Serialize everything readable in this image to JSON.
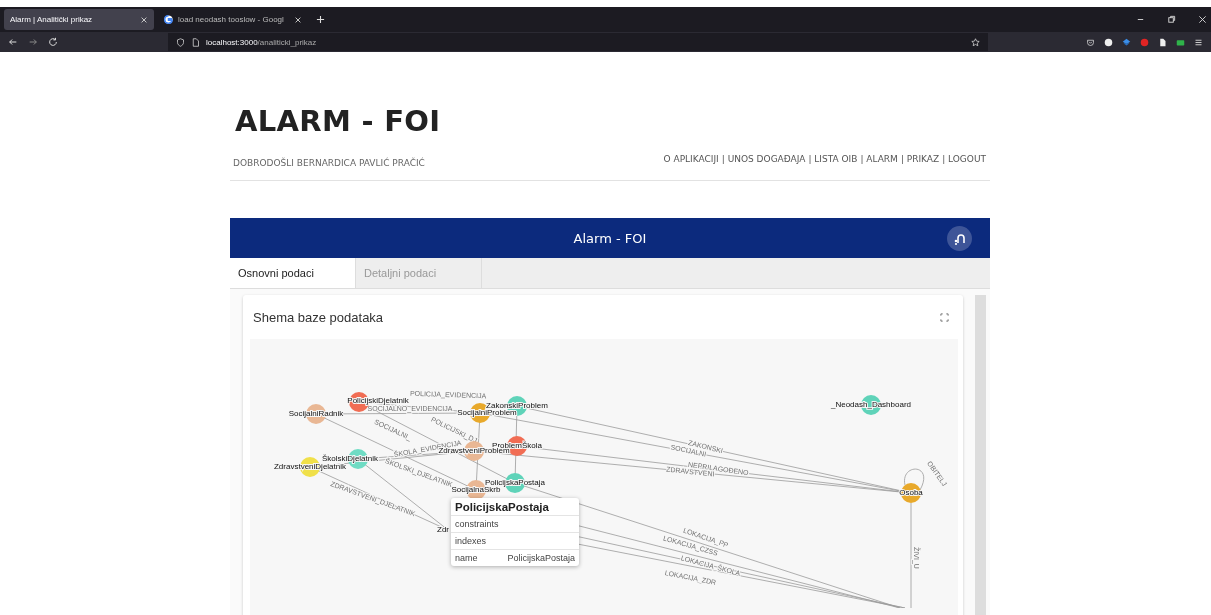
{
  "browser": {
    "tabs": [
      {
        "title": "Alarm | Analitički prikaz",
        "selected": true,
        "favicon": false
      },
      {
        "title": "load neodash tooslow - Googl",
        "selected": false,
        "favicon": true
      }
    ],
    "url_host": "localhost:3000",
    "url_path": "/analiticki_prikaz"
  },
  "site": {
    "title": "ALARM - FOI",
    "welcome": "DOBRODOŠLI BERNARDICA PAVLIĆ PRAČIĆ",
    "nav": [
      "O APLIKACIJI",
      "| UNOS DOGAĐAJA",
      "| LISTA OIB",
      "| ALARM",
      "| PRIKAZ",
      "| LOGOUT"
    ]
  },
  "app_bar": {
    "title": "Alarm - FOI"
  },
  "tabs": [
    {
      "label": "Osnovni podaci",
      "selected": true
    },
    {
      "label": "Detaljni podaci",
      "selected": false
    }
  ],
  "card": {
    "title": "Shema baze podataka",
    "graph": {
      "nodes": [
        {
          "label": "PolicijskiDjelatnik",
          "color": "#f16d54"
        },
        {
          "label": "SocijalniRadnik",
          "color": "#e9b794"
        },
        {
          "label": "SocijalniProblem",
          "color": "#e8a92b"
        },
        {
          "label": "ZakonskiProblem",
          "color": "#5fd3b9"
        },
        {
          "label": "ProblemŠkola",
          "color": "#f16d54"
        },
        {
          "label": "ZdravstveniProblem",
          "color": "#e9b794"
        },
        {
          "label": "ŠkolskiDjelatnik",
          "color": "#6fdcc4"
        },
        {
          "label": "ZdravstveniDjelatnik",
          "color": "#f0e04a"
        },
        {
          "label": "PolicijskaPostaja",
          "color": "#5fd3b9"
        },
        {
          "label": "SocijalnaSkrb",
          "color": "#e9b794"
        },
        {
          "label": "_Neodash_Dashboard",
          "color": "#5fd3b9"
        },
        {
          "label": "Osoba",
          "color": "#e8a92b"
        }
      ],
      "partial_label": "Zdr",
      "edge_labels": [
        "POLICIJA_EVIDENCIJA",
        "SOCIJALNO_EVIDENCIJA",
        "POLICIJSKI_DJ",
        "SOCIJALNI_",
        "ŠKOLA_EVIDENCIJA",
        "ŠKOLSKI_DJELATNIK",
        "ZDRAVSTVENI_DJELATNIK",
        "ZAKONSKI",
        "SOCIJALNI",
        "NEPRILAGOĐENO",
        "ZDRAVSTVENI",
        "OBITELJ",
        "ŽIVI_U",
        "LOKACIJA_PP",
        "LOKACIJA_CZSS",
        "LOKACIJA_ŠKOLA",
        "LOKACIJA_ZDR"
      ],
      "tooltip": {
        "title": "PolicijskaPostaja",
        "rows": [
          {
            "key": "constraints"
          },
          {
            "key": "indexes"
          },
          {
            "key": "name",
            "value": "PolicijskaPostaja"
          }
        ]
      }
    }
  }
}
